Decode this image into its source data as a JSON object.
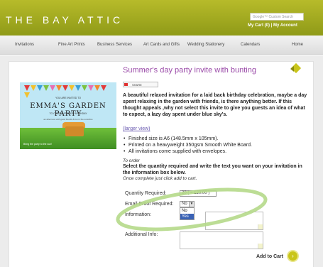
{
  "header": {
    "logo": "THE BAY ATTIC",
    "search_placeholder": "Google™ Custom Search",
    "cart_label": "My Cart (0)",
    "separator": "|",
    "account_label": "My Account"
  },
  "nav": {
    "items": [
      "Invitations",
      "Fine Art Prints",
      "Business Services",
      "Art Cards and Gifts",
      "Wedding Stationery",
      "Calendars",
      "Home"
    ]
  },
  "product": {
    "title": "Summer's day party invite with bunting",
    "share_label": "SHARE",
    "description": "A beautiful relaxed invitation for a laid back birthday celebration, maybe a day spent relaxing in the garden with friends, is there anything better. If this thought appeals ,why not select this invite to give you guests an idea of what to expect, a lazy day spent under blue sky's.",
    "larger_view": "(larger view)",
    "bullets": [
      "Finished size is A6 (148.5mm x 105mm).",
      "Printed on a heavyweight 350gsm Smooth White Board.",
      "All invitations come supplied with envelopes."
    ],
    "order_heading": "To order",
    "order_text": "Select the quantity required and write the text you want on your invitation in the information box below.",
    "order_note": "Once complete just click add to cart."
  },
  "invite_image": {
    "top_text": "YOU ARE INVITED TO",
    "title": "EMMA'S GARDEN PARTY",
    "subtitle": "TO CELEBRATE HER BIRTHDAY",
    "small_text": "an afternoon with good friends & fun in the sunshine",
    "bottom_text": "Bring the party to the sun!",
    "bunting_colors": [
      "#e23b3b",
      "#f2c12e",
      "#3aa0d8",
      "#7cc243",
      "#e86fb2",
      "#f28a2e"
    ]
  },
  "form": {
    "quantity_label": "Quantity Required:",
    "quantity_value": "20 ( = £20.00 )",
    "email_proof_label": "Email Proof Required:",
    "email_proof_value": "No",
    "email_proof_options": [
      "No",
      "Yes"
    ],
    "information_label": "Information:",
    "additional_label": "Additional Info:",
    "add_to_cart": "Add to Cart"
  },
  "colors": {
    "brand_green": "#a3aa1f",
    "title_purple": "#9a4aa8",
    "annotation_ring": "#b5d98a"
  }
}
